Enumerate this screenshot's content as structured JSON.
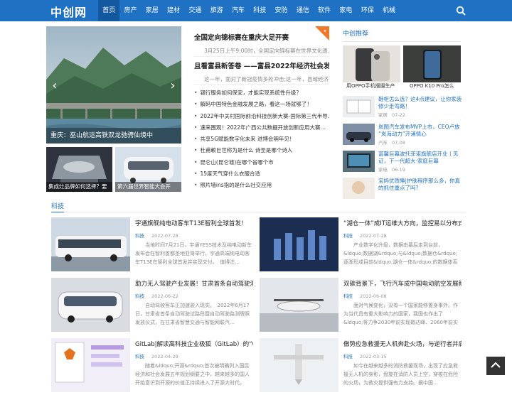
{
  "header": {
    "logo": "中创网",
    "nav": [
      "首页",
      "房产",
      "家居",
      "建材",
      "交通",
      "旅游",
      "汽车",
      "科技",
      "安防",
      "通信",
      "软件",
      "家电",
      "环保",
      "机械"
    ],
    "active_index": 0
  },
  "slider": {
    "caption": "重庆：巫山航运高铁双龙驰骋仙境中",
    "prev": "‹",
    "next": "›"
  },
  "thumbs": [
    {
      "caption": "集成灶品牌如何选择？要"
    },
    {
      "caption": "第六届世界智能大会开"
    }
  ],
  "headlines": [
    {
      "title": "全国定向锦标赛在重庆大足开赛",
      "summary": "3月25日上午9:00时，全国定向锦标赛在世界文化遗…"
    },
    {
      "title": "且看富县新答卷 ——富县2022年经济社会发展",
      "summary": "这一年，面对了新冠疫情多轮冲击;这一年，县域经济…"
    }
  ],
  "news": [
    "银行服务如何保安，才能实现系统性升级？",
    "解码中国特色金融发展之路，看这一场就够了！",
    "2022年中关村国际前沿科技创新大赛-国际第三代半导…",
    "速来围观！2022年广西公共数据开放创新应用大赛…",
    "共享5G赋能数字化未来 进博会明年见！",
    "杜甫赖巨世称为是什么 诗圣是哪个诗人",
    "昆仑山(昆仑墟)在哪个省哪个市",
    "15度天气穿什么衣服合适",
    "照片墙ins指的是什么社交应用"
  ],
  "recommend": {
    "title": "中创推荐",
    "top": [
      {
        "caption": "用OPPO手机摆摄生产"
      },
      {
        "caption": "OPPO K10 Pro怎么"
      }
    ],
    "items": [
      {
        "title": "鞋柜怎么选？这4点建议，让你家装修少走弯路！",
        "cat": "家居",
        "date": "07-22"
      },
      {
        "title": "岚图汽车发布MVP上市，CEO卢放 “岚海动力”开涌情心",
        "cat": "汽车",
        "date": "07-08"
      },
      {
        "title": "富馨巨幕波托菲诺旗舰店开业丨见证，下一代超大·家庭巨幕",
        "cat": "家电",
        "date": "06-19"
      },
      {
        "title": "宝妈优质睡|护肤程序那么多，你真的抓住重点了吗？",
        "cat": "",
        "date": ""
      }
    ]
  },
  "section": {
    "title": "科技",
    "articles": [
      {
        "title": "宇通旗舰纯电动客车T13E智利全球首发！",
        "cat": "科技",
        "date": "2022-07-28",
        "desc": "当地时间7月21日，宇通YESS技术及纯电动新车发布会在智利首都圣地亚哥举行，宇通高端纯电动客车T13E在智利全球首发并实现交付。　值得注…"
      },
      {
        "title": "“湖仓一体”成IT运维大方向，监控易以分布式",
        "cat": "科技",
        "date": "2022-07-28",
        "desc": "产业数字化升级，数据由幕后走到台前，&ldquo;数据湖&rdquo;与&ldquo;数据仓&rdquo;逐渐形成目前&ldquo;湖仓一体&rdquo;的数据体系进化趋势…"
      },
      {
        "title": "助力无人驾驶产业发展！甘肃首条自动驾驶测",
        "cat": "科技",
        "date": "2022-06-22",
        "desc": "自动驾驶客车正加速驶入现实。　2022年6月17日，甘肃省首条自动驾驶试路段暨自动驾驶路测牌照发放仪式，在甘肃省智慧交通与智能网联汽…"
      },
      {
        "title": "双碳背景下，飞行汽车成中国电动航空发展新",
        "cat": "科技",
        "date": "2022-06-08",
        "desc": "面对气候变化，没有一个国家能够置身事外。作为当代具有重大影响力的国家，我国也作出了&ldquo;将力争2030年前实现碳达峰、2060年前实现碳…"
      },
      {
        "title": "GitLab|解读高科技企业极狐（GitLab）的“中外",
        "cat": "科技",
        "date": "2022-04-29",
        "desc": "随着&ldquo;开源&rdquo;首次被明确列入国民经济和社会发展五年规划纲要之中，越来越多的国人开始意识到开源的价值正持续进入了开源大时代。2021…"
      },
      {
        "title": "傲势应急救援无人机奔赴火场，与逆行者并肩",
        "cat": "科技",
        "date": "2022-03-15",
        "desc": "如今在越来越多的消防救援现场，出现了应急救援无人机的身影，盘旋在消防人员上空，穿梭在危险的火场，为救灾提供强有力支持。据中国…"
      }
    ]
  },
  "colors": {
    "brand": "#1f71c4",
    "nav_active": "#1459a0"
  },
  "icons": {
    "search": "search-icon",
    "back_to_top": "arrow-up-icon"
  }
}
